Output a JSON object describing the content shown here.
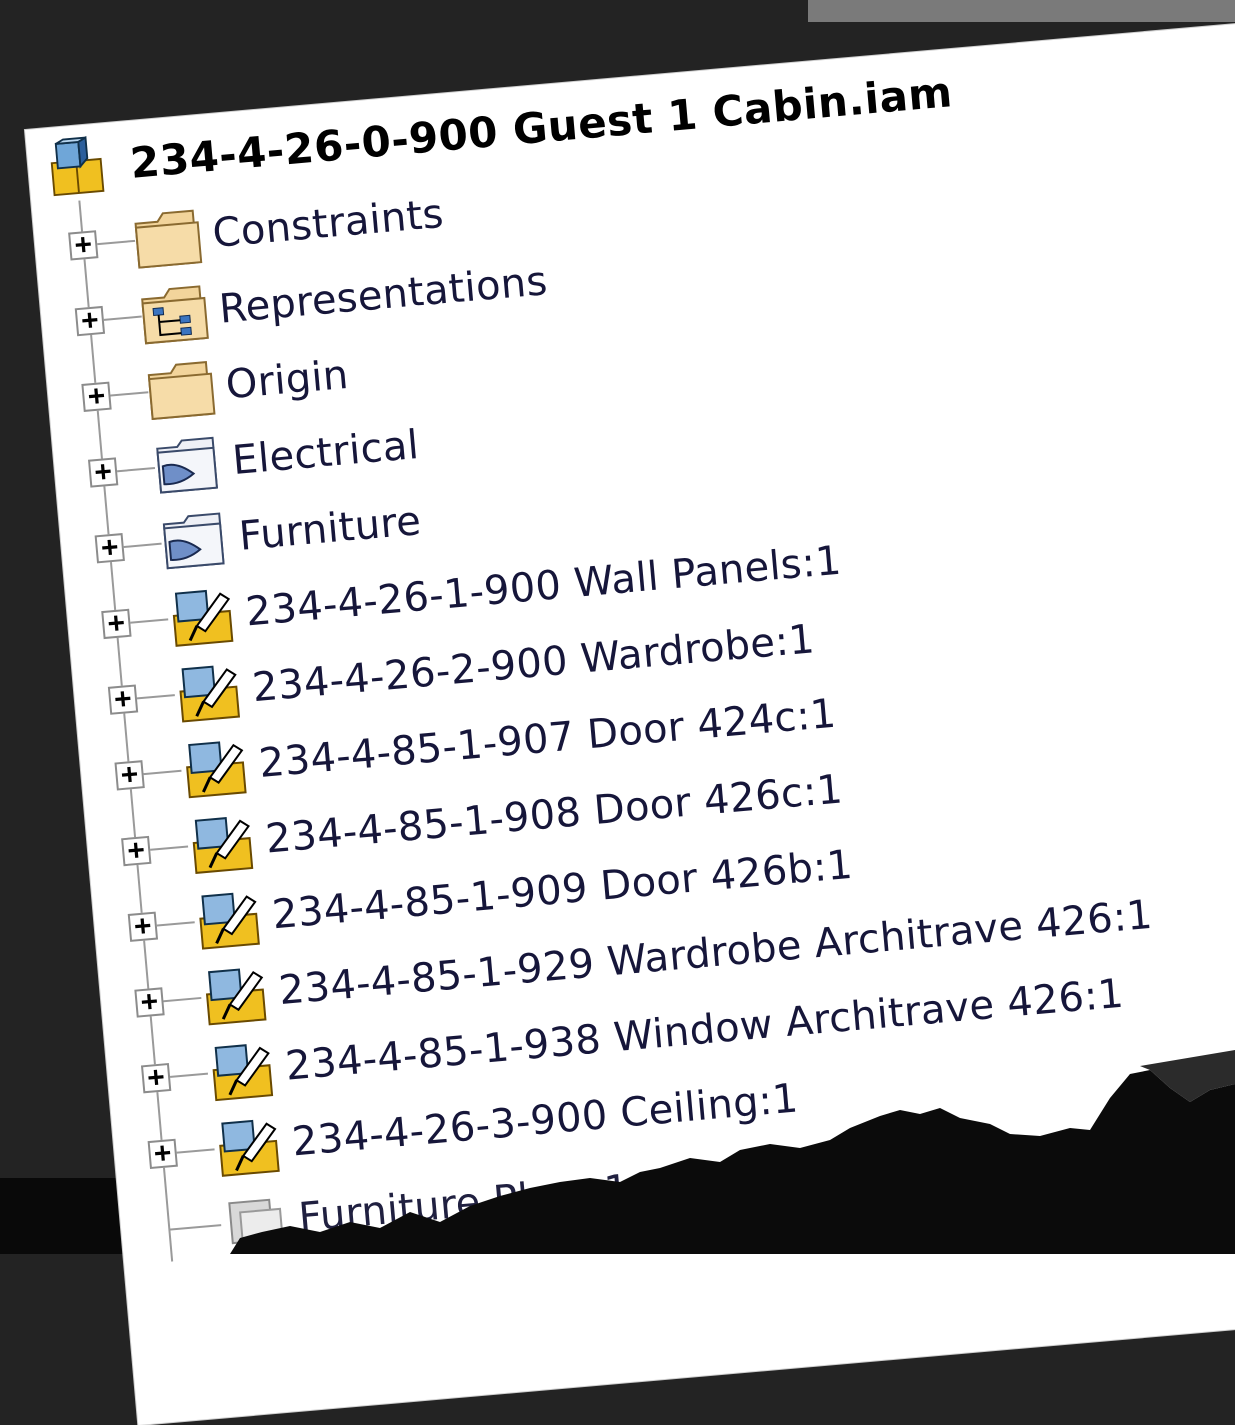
{
  "model_tree": {
    "root": {
      "label": "234-4-26-0-900 Guest 1 Cabin.iam",
      "icon": "assembly-icon"
    },
    "items": [
      {
        "label": "Constraints",
        "icon": "folder-icon",
        "expander": "+"
      },
      {
        "label": "Representations",
        "icon": "representations-folder-icon",
        "expander": "+"
      },
      {
        "label": "Origin",
        "icon": "folder-icon",
        "expander": "+"
      },
      {
        "label": "Electrical",
        "icon": "browser-folder-icon",
        "expander": "+"
      },
      {
        "label": "Furniture",
        "icon": "browser-folder-icon",
        "expander": "+"
      },
      {
        "label": "234-4-26-1-900 Wall Panels:1",
        "icon": "subassembly-icon",
        "expander": "+"
      },
      {
        "label": "234-4-26-2-900 Wardrobe:1",
        "icon": "subassembly-icon",
        "expander": "+"
      },
      {
        "label": "234-4-85-1-907 Door 424c:1",
        "icon": "subassembly-icon",
        "expander": "+"
      },
      {
        "label": "234-4-85-1-908 Door 426c:1",
        "icon": "subassembly-icon",
        "expander": "+"
      },
      {
        "label": "234-4-85-1-909 Door 426b:1",
        "icon": "subassembly-icon",
        "expander": "+"
      },
      {
        "label": "234-4-85-1-929 Wardrobe Architrave 426:1",
        "icon": "subassembly-icon",
        "expander": "+"
      },
      {
        "label": "234-4-85-1-938 Window Architrave 426:1",
        "icon": "subassembly-icon",
        "expander": "+"
      },
      {
        "label": "234-4-26-3-900 Ceiling:1",
        "icon": "subassembly-icon",
        "expander": "+"
      },
      {
        "label": "Furniture Plane1",
        "icon": "work-plane-icon",
        "expander": ""
      }
    ]
  },
  "colors": {
    "folder": "#f2d49b",
    "assembly_yellow": "#f0c020",
    "label_text": "#16163a",
    "background": "#232323"
  }
}
